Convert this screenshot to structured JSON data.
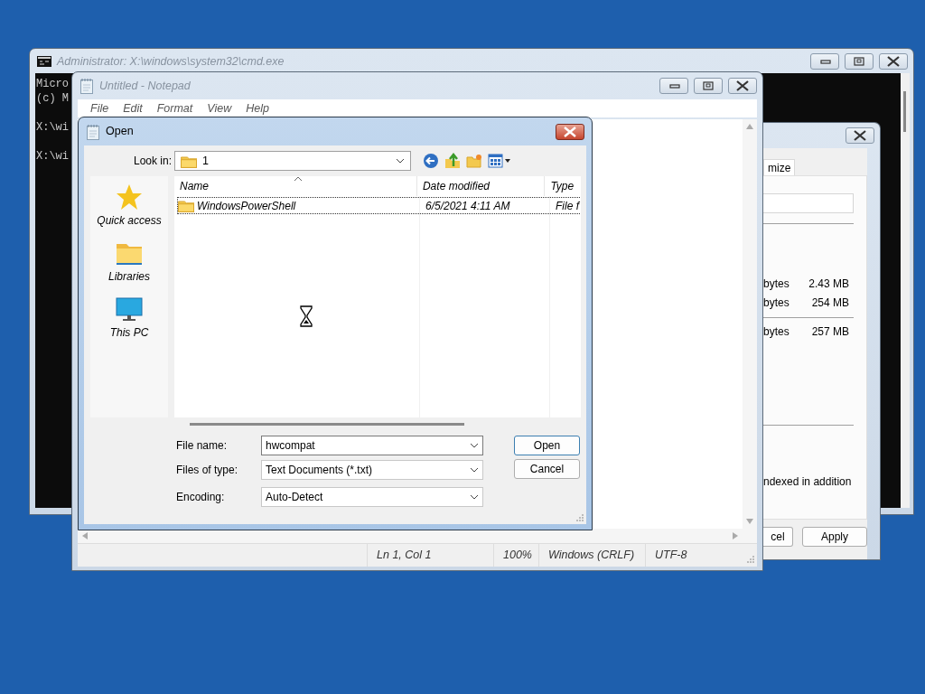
{
  "console_window": {
    "title": "Administrator: X:\\windows\\system32\\cmd.exe",
    "paragraphs": [
      [
        "Micro",
        "(c) M"
      ],
      [
        "X:\\wi"
      ],
      [
        "X:\\wi"
      ]
    ]
  },
  "properties_window": {
    "tab": {
      "label": "mize",
      "selected": true
    },
    "rows": [
      {
        "column_1": "bytes",
        "column_2": "2.43 MB"
      },
      {
        "column_1": "bytes",
        "column_2": "254 MB"
      },
      {
        "column_1": "bytes",
        "column_2": "257 MB"
      }
    ],
    "note": "ndexed in addition",
    "buttons": [
      "cel",
      "Apply"
    ]
  },
  "notepad_window": {
    "title": "Untitled - Notepad",
    "menu": [
      "File",
      "Edit",
      "Format",
      "View",
      "Help"
    ],
    "status_bar": [
      "Ln 1, Col 1",
      "100%",
      "Windows (CRLF)",
      "UTF-8"
    ]
  },
  "open_dialog": {
    "title": "Open",
    "look_in": {
      "label": "Look in:",
      "value": "1"
    },
    "places": [
      {
        "label": "Quick access",
        "kind": "star"
      },
      {
        "label": "Libraries",
        "kind": "folder"
      },
      {
        "label": "This PC",
        "kind": "monitor"
      }
    ],
    "file_list": {
      "columns": [
        "Name",
        "Date modified",
        "Type"
      ],
      "rows": [
        {
          "name": "WindowsPowerShell",
          "date_modified": "6/5/2021 4:11 AM",
          "type": "File f",
          "focused": true
        }
      ]
    },
    "file_name": {
      "label": "File name:",
      "value": "hwcompat"
    },
    "file_type": {
      "label": "Files of type:",
      "value": "Text Documents (*.txt)"
    },
    "encoding": {
      "label": "Encoding:",
      "value": "Auto-Detect"
    },
    "buttons": [
      "Open",
      "Cancel"
    ]
  }
}
